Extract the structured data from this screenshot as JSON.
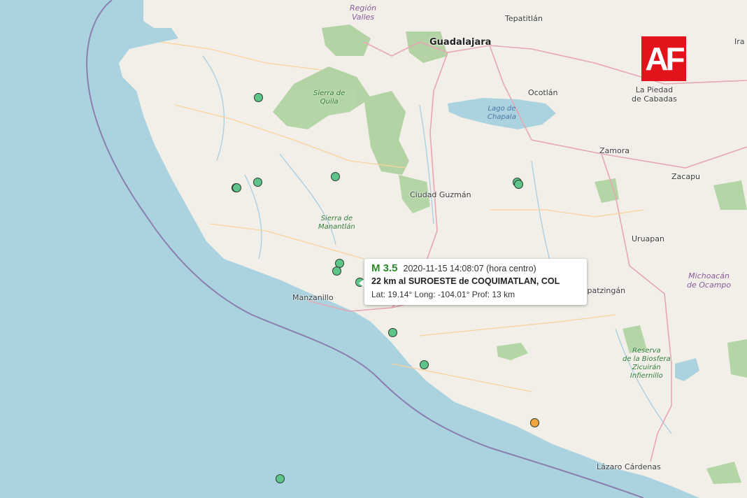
{
  "colors": {
    "water": "#aad3df",
    "land": "#f2efe9",
    "forest": "#add19e",
    "quake_green": "#5ec48a",
    "quake_orange": "#f0a43c",
    "magnitude_text": "#2a8a2a",
    "logo_bg": "#e3131b"
  },
  "logo": {
    "text": "AF"
  },
  "places": [
    {
      "id": "guadalajara",
      "name": "Guadalajara"
    },
    {
      "id": "tepatitlan",
      "name": "Tepatitlán"
    },
    {
      "id": "ocotlan",
      "name": "Ocotlán"
    },
    {
      "id": "zamora",
      "name": "Zamora"
    },
    {
      "id": "zacapu",
      "name": "Zacapu"
    },
    {
      "id": "uruapan",
      "name": "Uruapan"
    },
    {
      "id": "apatzingan",
      "name": "Apatzingán"
    },
    {
      "id": "ciudad-guzman",
      "name": "Ciudad Guzmán"
    },
    {
      "id": "manzanillo",
      "name": "Manzanillo"
    },
    {
      "id": "lazaro-cardenas",
      "name": "Lázaro Cárdenas"
    },
    {
      "id": "ira",
      "name": "Ira"
    }
  ],
  "multiline_places": {
    "la_piedad": [
      "La Piedad",
      "de Cabadas"
    ],
    "region_valles": [
      "Región",
      "Valles"
    ],
    "michoacan": [
      "Michoacán",
      "de Ocampo"
    ]
  },
  "parks": {
    "sierra_quila": [
      "Sierra de",
      "Quila"
    ],
    "sierra_manantlan": [
      "Sierra de",
      "Manantlán"
    ],
    "reserva": [
      "Reserva",
      "de la Biosfera",
      "Zicuirán",
      "Infiernillo"
    ]
  },
  "lake": [
    "Lago de",
    "Chapala"
  ],
  "earthquakes": [
    {
      "lat": 20.1,
      "lon": -105.2,
      "status": "green"
    },
    {
      "lat": 19.69,
      "lon": -104.3,
      "status": "green"
    },
    {
      "lat": 19.66,
      "lon": -105.21,
      "status": "green"
    },
    {
      "lat": 19.63,
      "lon": -105.47,
      "status": "green"
    },
    {
      "lat": 19.63,
      "lon": -105.46,
      "status": "green"
    },
    {
      "lat": 19.24,
      "lon": -104.25,
      "status": "green"
    },
    {
      "lat": 19.2,
      "lon": -104.28,
      "status": "green"
    },
    {
      "lat": 19.14,
      "lon": -104.01,
      "status": "green"
    },
    {
      "lat": 19.66,
      "lon": -102.16,
      "status": "green"
    },
    {
      "lat": 19.65,
      "lon": -102.14,
      "status": "green"
    },
    {
      "lat": 18.88,
      "lon": -103.62,
      "status": "green"
    },
    {
      "lat": 18.71,
      "lon": -103.25,
      "status": "green"
    },
    {
      "lat": 18.41,
      "lon": -101.95,
      "status": "orange"
    },
    {
      "lat": 18.12,
      "lon": -104.95,
      "status": "green"
    }
  ],
  "popup": {
    "magnitude": "M 3.5",
    "datetime": "2020-11-15  14:08:07 (hora centro)",
    "location": "22 km al SUROESTE de COQUIMATLAN, COL",
    "details": "Lat: 19.14°  Long: -104.01°  Prof: 13 km"
  }
}
